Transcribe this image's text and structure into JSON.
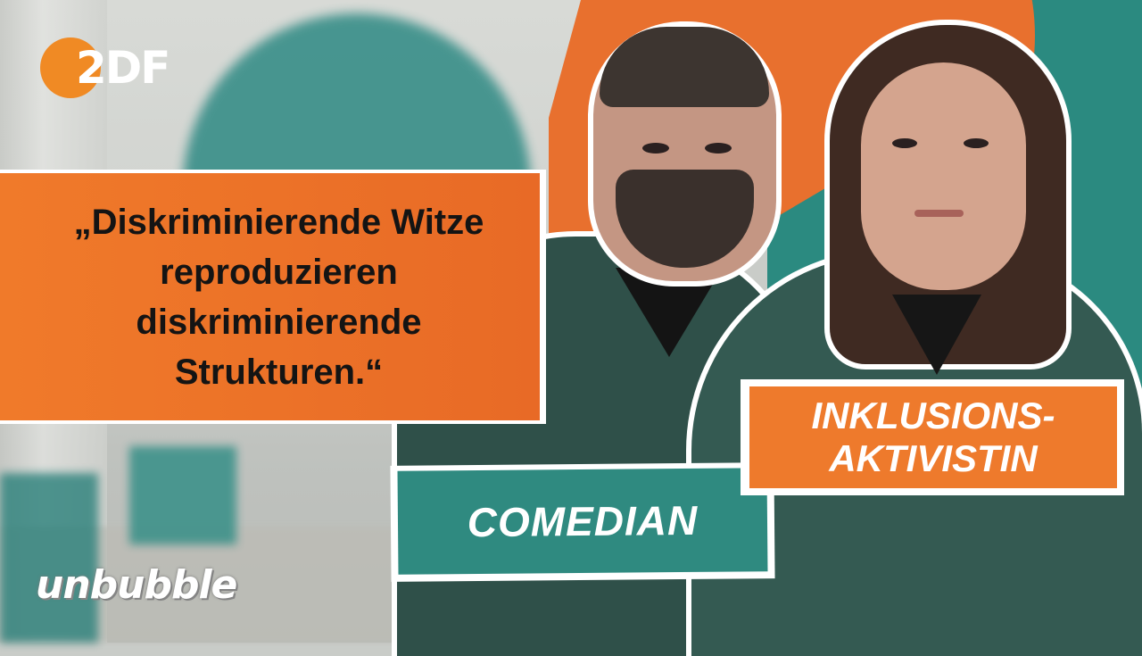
{
  "logo": {
    "brand": "2DF"
  },
  "quote": {
    "lines": [
      "„Diskriminierende Witze",
      "reproduzieren",
      "diskriminierende",
      "Strukturen.“"
    ]
  },
  "labels": {
    "comedian": "COMEDIAN",
    "activist_line1": "INKLUSIONS-",
    "activist_line2": "AKTIVISTIN"
  },
  "show": {
    "name": "unbubble"
  },
  "colors": {
    "orange": "#e8702e",
    "teal": "#2b8a80",
    "logo_orange": "#f08a24"
  }
}
